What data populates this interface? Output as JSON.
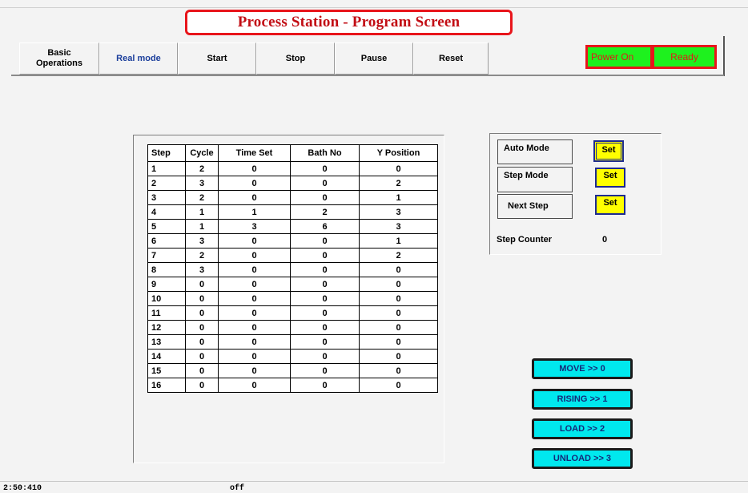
{
  "title": "Process Station - Program Screen",
  "toolbar": {
    "buttons": [
      "Basic\nOperations",
      "Real mode",
      "Start",
      "Stop",
      "Pause",
      "Reset"
    ]
  },
  "status_indicators": {
    "power": "Power On",
    "ready": "Ready"
  },
  "program_table": {
    "headers": [
      "Step",
      "Cycle",
      "Time Set",
      "Bath No",
      "Y Position"
    ],
    "rows": [
      [
        "1",
        "2",
        "0",
        "0",
        "0"
      ],
      [
        "2",
        "3",
        "0",
        "0",
        "2"
      ],
      [
        "3",
        "2",
        "0",
        "0",
        "1"
      ],
      [
        "4",
        "1",
        "1",
        "2",
        "3"
      ],
      [
        "5",
        "1",
        "3",
        "6",
        "3"
      ],
      [
        "6",
        "3",
        "0",
        "0",
        "1"
      ],
      [
        "7",
        "2",
        "0",
        "0",
        "2"
      ],
      [
        "8",
        "3",
        "0",
        "0",
        "0"
      ],
      [
        "9",
        "0",
        "0",
        "0",
        "0"
      ],
      [
        "10",
        "0",
        "0",
        "0",
        "0"
      ],
      [
        "11",
        "0",
        "0",
        "0",
        "0"
      ],
      [
        "12",
        "0",
        "0",
        "0",
        "0"
      ],
      [
        "13",
        "0",
        "0",
        "0",
        "0"
      ],
      [
        "14",
        "0",
        "0",
        "0",
        "0"
      ],
      [
        "15",
        "0",
        "0",
        "0",
        "0"
      ],
      [
        "16",
        "0",
        "0",
        "0",
        "0"
      ]
    ]
  },
  "mode_panel": {
    "auto_mode": "Auto Mode",
    "step_mode": "Step Mode",
    "next_step": "Next Step",
    "set_label": "Set",
    "step_counter_label": "Step Counter",
    "step_counter_value": "0"
  },
  "actions": {
    "move": "MOVE >> 0",
    "rising": "RISING >> 1",
    "load": "LOAD >> 2",
    "unload": "UNLOAD >> 3"
  },
  "status_bar": {
    "time": "2:50:410",
    "state": "off"
  },
  "colors": {
    "title_red": "#c20d14",
    "status_green": "#1ef11e",
    "set_yellow": "#ffff00",
    "action_cyan": "#00e8ee"
  }
}
